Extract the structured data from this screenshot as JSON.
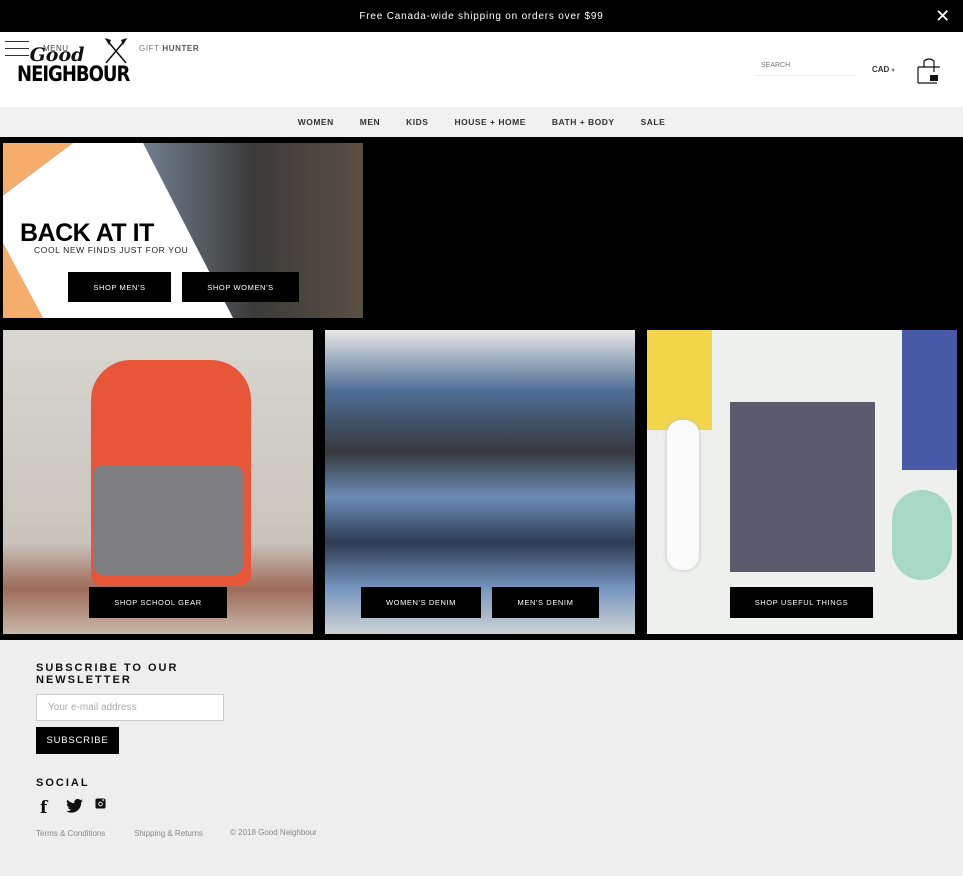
{
  "announcement": {
    "text": "Free Canada-wide shipping on orders over $99",
    "close_icon": "close-icon"
  },
  "header": {
    "menu_label": "MENU",
    "logo": {
      "line1": "Good",
      "line2": "NEIGHBOUR"
    },
    "gift_hunter": {
      "prefix": "GIFT",
      "suffix": "HUNTER"
    },
    "search_placeholder": "SEARCH",
    "currency": "CAD"
  },
  "nav": [
    {
      "label": "WOMEN"
    },
    {
      "label": "MEN"
    },
    {
      "label": "KIDS"
    },
    {
      "label": "HOUSE + HOME"
    },
    {
      "label": "BATH + BODY"
    },
    {
      "label": "SALE"
    }
  ],
  "hero": {
    "title": "BACK AT IT",
    "subtitle": "COOL NEW FINDS JUST FOR YOU",
    "buttons": [
      "SHOP MEN'S",
      "SHOP WOMEN'S"
    ],
    "accent": "#f6ad6b"
  },
  "tiles": [
    {
      "buttons": [
        "SHOP SCHOOL GEAR"
      ]
    },
    {
      "buttons": [
        "WOMEN'S DENIM",
        "MEN'S DENIM"
      ]
    },
    {
      "buttons": [
        "SHOP USEFUL THINGS"
      ]
    }
  ],
  "footer": {
    "newsletter_title_1": "SUBSCRIBE TO OUR",
    "newsletter_title_2": "NEWSLETTER",
    "email_placeholder": "Your e-mail address",
    "subscribe_label": "SUBSCRIBE",
    "social_title": "SOCIAL",
    "social": [
      "facebook-icon",
      "twitter-icon",
      "instagram-icon"
    ],
    "links": [
      "Terms & Conditions",
      "Shipping & Returns"
    ],
    "copyright": "© 2018 Good Neighbour"
  }
}
